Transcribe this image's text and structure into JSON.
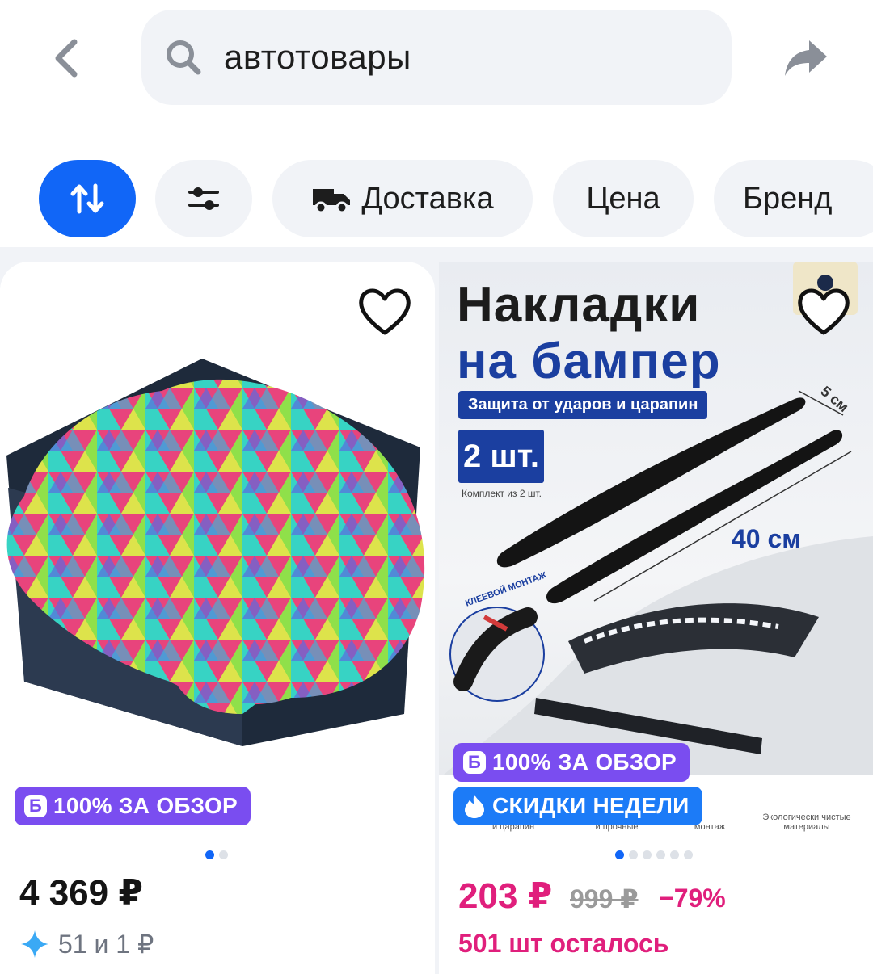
{
  "search": {
    "query": "автотовары"
  },
  "filters": {
    "delivery_label": "Доставка",
    "price_label": "Цена",
    "brand_label": "Бренд"
  },
  "colors": {
    "accent": "#1166f7",
    "review_badge": "#7a4df0",
    "sale_badge": "#1c7bf7",
    "sale_price": "#e01f7c"
  },
  "products": [
    {
      "badge_review_icon": "Б",
      "badge_review": "100% ЗА ОБЗОР",
      "image_pages": 2,
      "image_active_page": 1,
      "price": "4 369 ₽",
      "bonus": "51 и 1 ₽"
    },
    {
      "image": {
        "title_line1": "Накладки",
        "title_line2": "на бампер",
        "subtitle": "Защита от ударов и царапин",
        "quantity": "2 шт.",
        "kit": "Комплект из 2 шт.",
        "length": "40 см",
        "width": "5 см",
        "mount": "КЛЕЕВОЙ МОНТАЖ",
        "feat_1": "и царапин",
        "feat_2": "и прочные",
        "feat_3": "монтаж",
        "feat_4": "Экологически чистые материалы"
      },
      "badge_review_icon": "Б",
      "badge_review": "100% ЗА ОБЗОР",
      "badge_sale": "СКИДКИ НЕДЕЛИ",
      "image_pages": 6,
      "image_active_page": 1,
      "price": "203 ₽",
      "old_price": "999 ₽",
      "discount": "−79%",
      "stock": "501 шт осталось"
    }
  ]
}
